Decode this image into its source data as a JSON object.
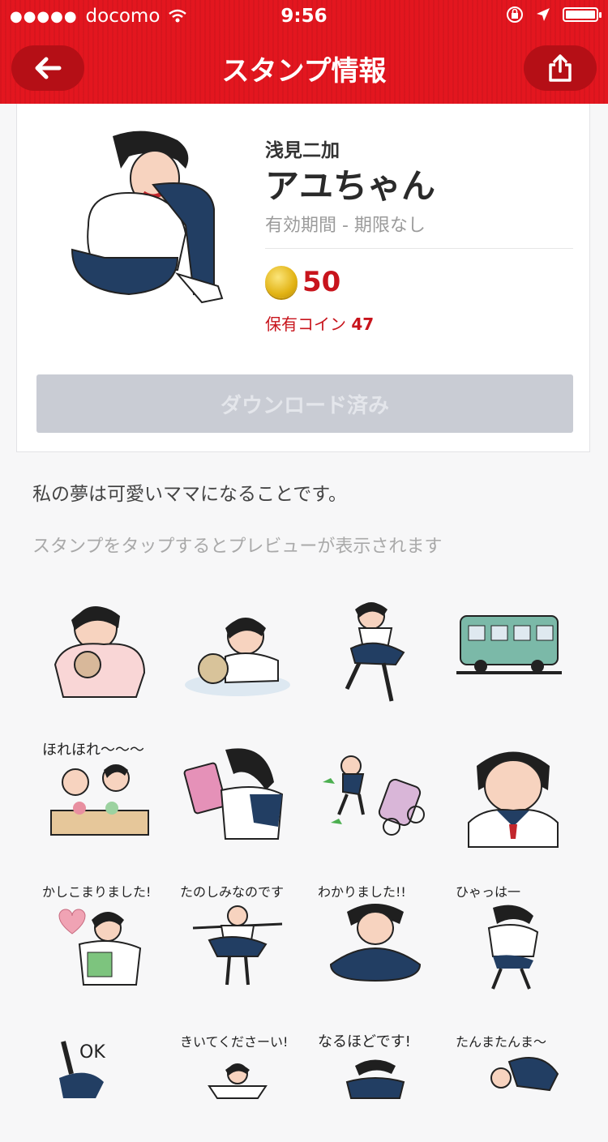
{
  "status_bar": {
    "carrier": "docomo",
    "time": "9:56"
  },
  "nav": {
    "title": "スタンプ情報"
  },
  "sticker": {
    "author": "浅見二加",
    "name": "アユちゃん",
    "period": "有効期間 - 期限なし",
    "price": "50",
    "owned_label": "保有コイン",
    "owned_value": "47",
    "download_label": "ダウンロード済み"
  },
  "description": "私の夢は可愛いママになることです。",
  "preview_hint": "スタンプをタップするとプレビューが表示されます",
  "stamp_captions": [
    "ほれほれ〜〜〜",
    "かしこまりました!",
    "たのしみなのです",
    "わかりました!!",
    "ひゃっは一",
    "OK",
    "きいてくださーい!",
    "なるほどです!",
    "たんまたんま〜"
  ],
  "colors": {
    "brand_red": "#e3161f",
    "price_red": "#c8141c",
    "button_disabled": "#c9ccd4"
  }
}
